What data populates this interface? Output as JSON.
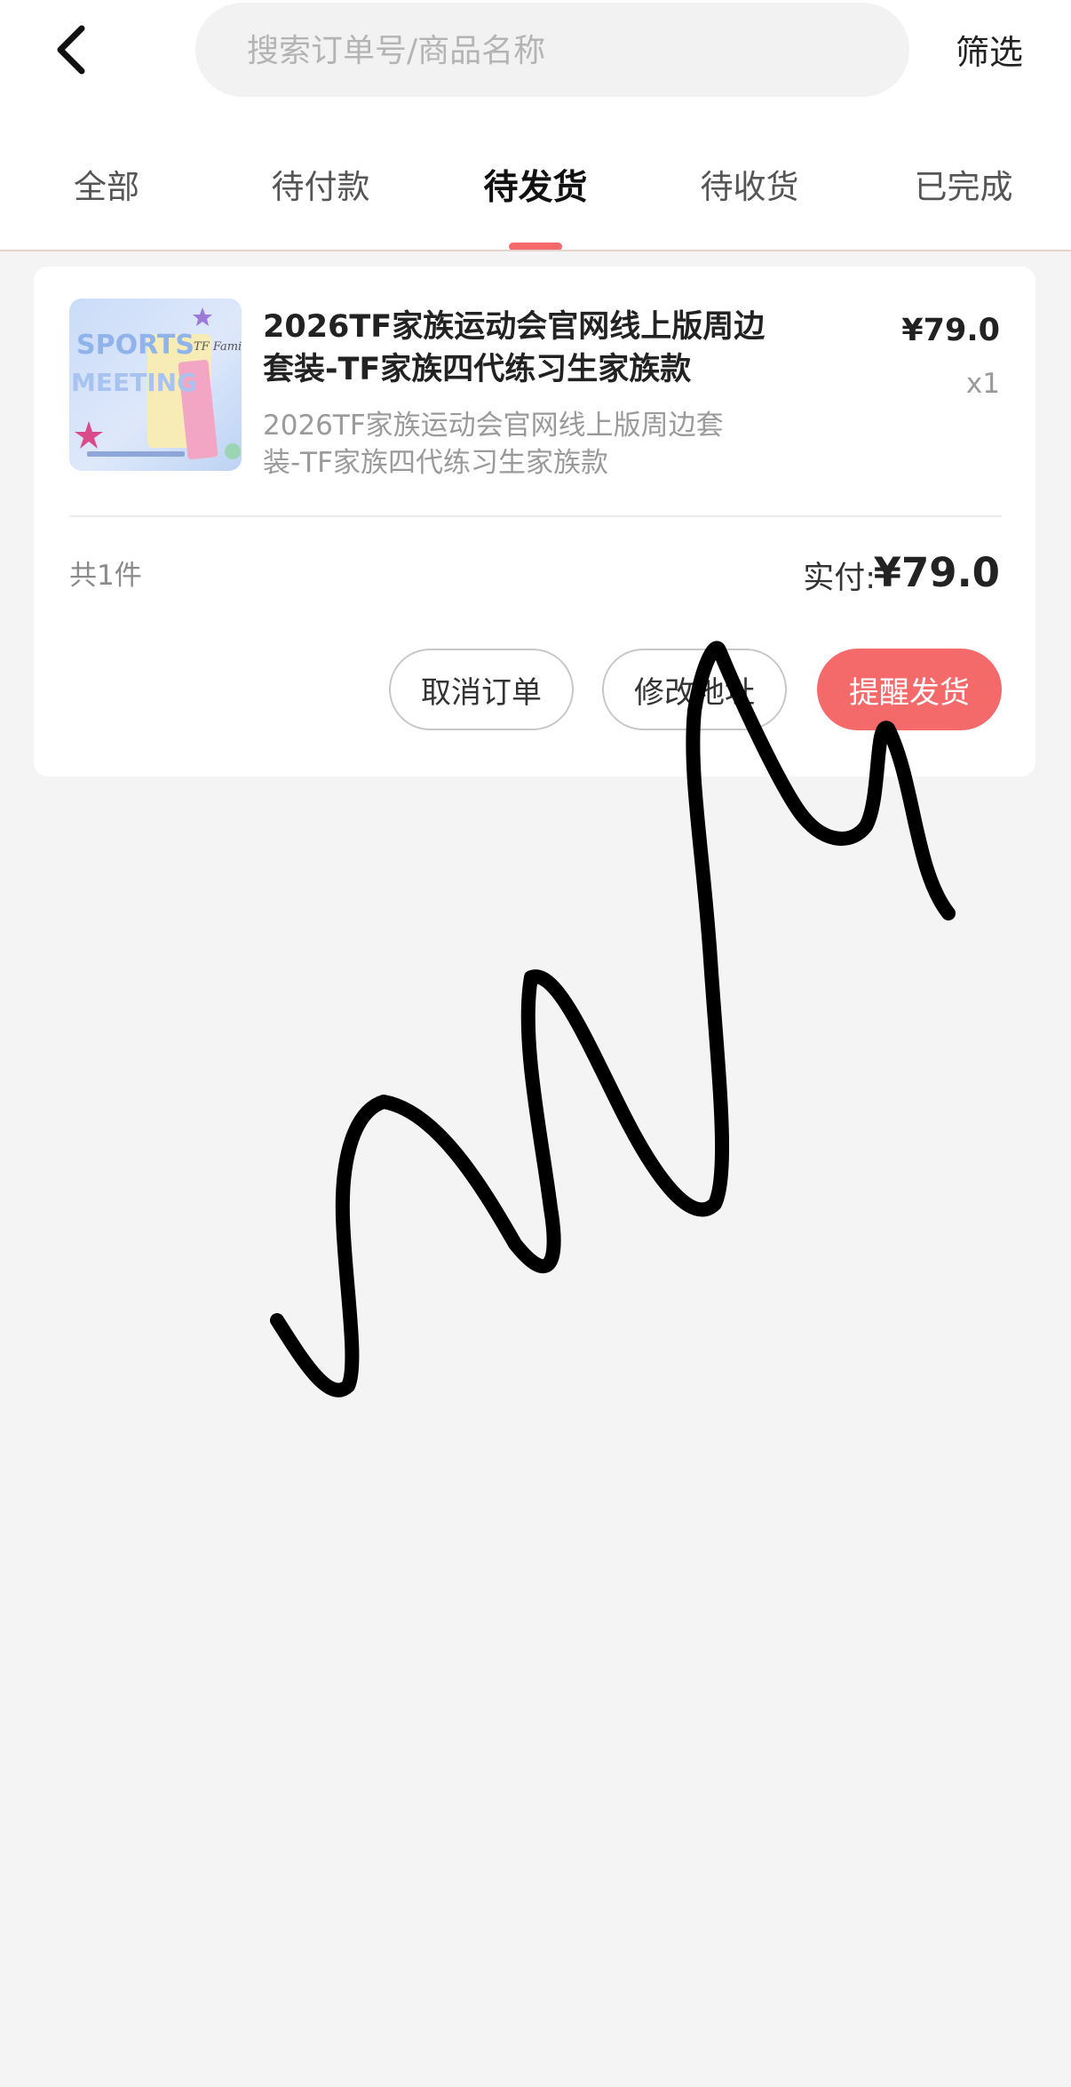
{
  "header": {
    "search_placeholder": "搜索订单号/商品名称",
    "filter_label": "筛选"
  },
  "tabs": [
    {
      "label": "全部",
      "active": false
    },
    {
      "label": "待付款",
      "active": false
    },
    {
      "label": "待发货",
      "active": true
    },
    {
      "label": "待收货",
      "active": false
    },
    {
      "label": "已完成",
      "active": false
    }
  ],
  "order": {
    "product_title": "2026TF家族运动会官网线上版周边套装-TF家族四代练习生家族款",
    "product_subtitle": "2026TF家族运动会官网线上版周边套装-TF家族四代练习生家族款",
    "price": "¥79.0",
    "quantity": "x1",
    "item_count": "共1件",
    "paid_label": "实付:",
    "paid_amount": "¥79.0",
    "buttons": {
      "cancel": "取消订单",
      "modify_address": "修改地址",
      "remind_ship": "提醒发货"
    },
    "thumbnail_text": {
      "line1": "SPORTS",
      "line2": "MEETING",
      "brand": "TF Family"
    }
  },
  "colors": {
    "accent": "#f46a6a",
    "page_background": "#f4f4f4",
    "card_background": "#ffffff"
  },
  "icons": {
    "back": "chevron-left-icon"
  }
}
